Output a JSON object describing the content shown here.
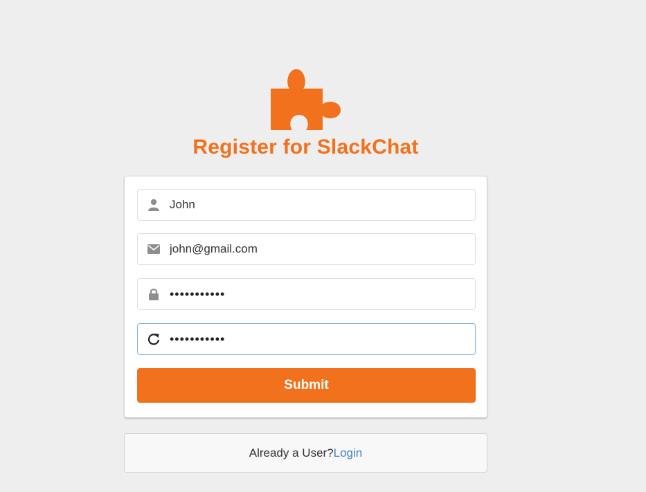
{
  "header": {
    "logo_icon": "puzzle-piece-icon",
    "title": "Register for SlackChat",
    "accent_color": "#f2711c"
  },
  "form": {
    "username": {
      "icon": "user-icon",
      "value": "John"
    },
    "email": {
      "icon": "mail-icon",
      "value": "john@gmail.com"
    },
    "password": {
      "icon": "lock-icon",
      "value": "•••••••••••"
    },
    "password_confirmation": {
      "icon": "repeat-icon",
      "value": "•••••••••••"
    },
    "submit_label": "Submit"
  },
  "footer": {
    "prompt": "Already a User?",
    "login_link": "Login",
    "link_color": "#4183c4"
  }
}
